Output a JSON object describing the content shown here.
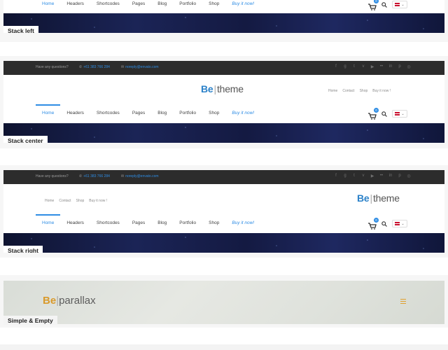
{
  "menu": {
    "items": [
      {
        "label": "Home",
        "active": true
      },
      {
        "label": "Headers"
      },
      {
        "label": "Shortcodes"
      },
      {
        "label": "Pages"
      },
      {
        "label": "Blog"
      },
      {
        "label": "Portfolio"
      },
      {
        "label": "Shop"
      }
    ],
    "buy_label": "Buy it now!"
  },
  "cart": {
    "count": "0"
  },
  "language": {
    "code": "⌄"
  },
  "topbar": {
    "question": "Have any questions?",
    "phone": "+61 383 766 284",
    "email": "noreply@envato.com",
    "social_icons": [
      "facebook-icon",
      "google-plus-icon",
      "twitter-icon",
      "vimeo-icon",
      "youtube-icon",
      "flickr-icon",
      "linkedin-icon",
      "pinterest-icon",
      "dribbble-icon"
    ]
  },
  "logo": {
    "be": "Be",
    "word": "theme"
  },
  "secondary_links": [
    "Home",
    "Contact",
    "Shop",
    "Buy it now !"
  ],
  "sections": {
    "stack_left": "Stack left",
    "stack_center": "Stack center",
    "stack_right": "Stack right",
    "simple_empty": "Simple & Empty"
  },
  "parallax": {
    "be": "Be",
    "word": "parallax"
  },
  "colors": {
    "accent": "#2f8de4",
    "parallax_accent": "#d99a2b",
    "topbar": "#2c2c2c"
  }
}
